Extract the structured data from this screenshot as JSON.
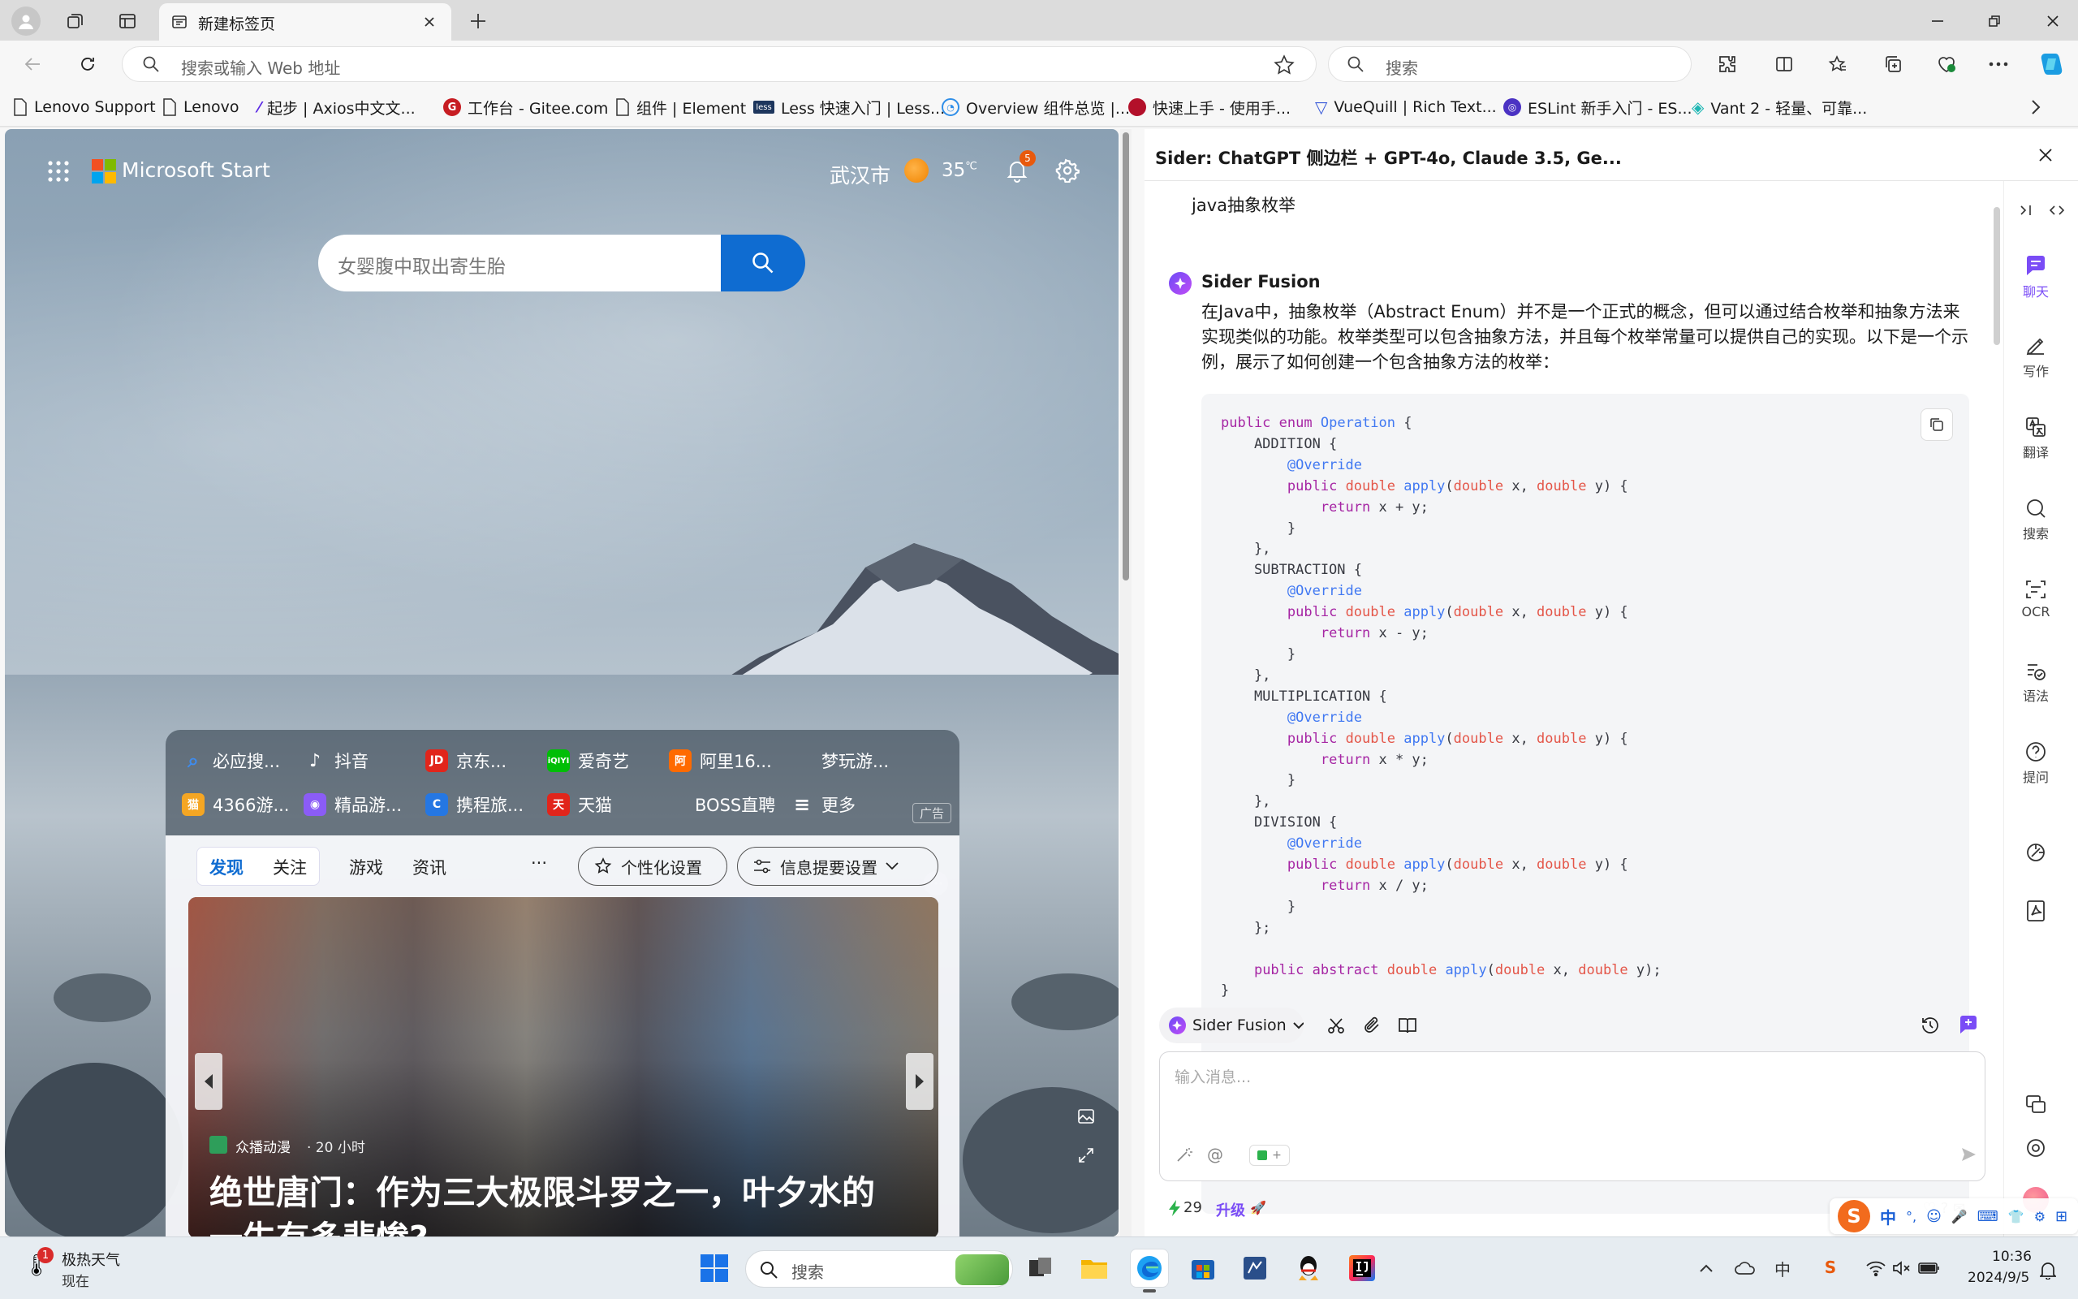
{
  "browser": {
    "tab_title": "新建标签页",
    "address_placeholder": "搜索或输入 Web 地址",
    "search_placeholder": "搜索",
    "favorites": [
      {
        "label": "Lenovo Support",
        "icon": "page-icon"
      },
      {
        "label": "Lenovo",
        "icon": "page-icon"
      },
      {
        "label": "起步 | Axios中文文...",
        "icon": "axios-icon"
      },
      {
        "label": "工作台 - Gitee.com",
        "icon": "gitee-icon"
      },
      {
        "label": "组件 | Element",
        "icon": "page-icon"
      },
      {
        "label": "Less 快速入门 | Less...",
        "icon": "less-icon"
      },
      {
        "label": "Overview 组件总览 |...",
        "icon": "overview-icon"
      },
      {
        "label": "快速上手 - 使用手...",
        "icon": "quickstart-icon"
      },
      {
        "label": "VueQuill | Rich Text...",
        "icon": "vuequill-icon"
      },
      {
        "label": "ESLint 新手入门 - ES...",
        "icon": "eslint-icon"
      },
      {
        "label": "Vant 2 - 轻量、可靠...",
        "icon": "vant-icon"
      }
    ]
  },
  "newtab": {
    "brand": "Microsoft Start",
    "city": "武汉市",
    "temperature": "35",
    "temp_unit": "℃",
    "notification_count": "5",
    "search_placeholder": "女婴腹中取出寄生胎",
    "shortcuts_row1": [
      {
        "label": "必应搜...",
        "color": "#2a6fd6",
        "glyph": "⌕"
      },
      {
        "label": "抖音",
        "color": "",
        "glyph": ""
      },
      {
        "label": "京东...",
        "color": "#e1251b",
        "glyph": "JD"
      },
      {
        "label": "爱奇艺",
        "color": "#00be06",
        "glyph": "iQ"
      },
      {
        "label": "阿里16...",
        "color": "#ff6a00",
        "glyph": "阿"
      },
      {
        "label": "梦玩游...",
        "color": "",
        "glyph": ""
      }
    ],
    "shortcuts_row2": [
      {
        "label": "4366游...",
        "color": "#f5a623",
        "glyph": "猫"
      },
      {
        "label": "精品游...",
        "color": "#8b5cf6",
        "glyph": "🎮"
      },
      {
        "label": "携程旅...",
        "color": "#2577e3",
        "glyph": "C"
      },
      {
        "label": "天猫",
        "color": "#e1251b",
        "glyph": "天"
      },
      {
        "label": "BOSS直聘",
        "color": "",
        "glyph": ""
      },
      {
        "label": "更多",
        "color": "",
        "glyph": "≡"
      }
    ],
    "ad_label": "广告",
    "feed_tabs": [
      "发现",
      "关注",
      "游戏",
      "资讯"
    ],
    "feed_more": "···",
    "personalize_button": "个性化设置",
    "info_settings_button": "信息提要设置",
    "article_source": "众播动漫",
    "article_time": "· 20 小时",
    "article_title": "绝世唐门：作为三大极限斗罗之一，叶夕水的一生有多悲惨?"
  },
  "sider": {
    "title": "Sider: ChatGPT 侧边栏 + GPT-4o, Claude 3.5, Ge...",
    "user_message": "java抽象枚举",
    "assistant_name": "Sider Fusion",
    "assistant_text": "在Java中，抽象枚举（Abstract Enum）并不是一个正式的概念，但可以通过结合枚举和抽象方法来实现类似的功能。枚举类型可以包含抽象方法，并且每个枚举常量可以提供自己的实现。以下是一个示例，展示了如何创建一个包含抽象方法的枚举：",
    "model_selector": "Sider Fusion",
    "input_placeholder": "输入消息...",
    "credits": "29",
    "upgrade_label": "升级",
    "rail": [
      {
        "label": "聊天",
        "icon": "chat-icon",
        "active": true
      },
      {
        "label": "写作",
        "icon": "write-icon",
        "active": false
      },
      {
        "label": "翻译",
        "icon": "translate-icon",
        "active": false
      },
      {
        "label": "搜索",
        "icon": "search-icon",
        "active": false
      },
      {
        "label": "OCR",
        "icon": "ocr-icon",
        "active": false
      },
      {
        "label": "语法",
        "icon": "grammar-icon",
        "active": false
      },
      {
        "label": "提问",
        "icon": "ask-icon",
        "active": false
      }
    ]
  },
  "code_lines": [
    "public enum Operation {",
    "    ADDITION {",
    "        @Override",
    "        public double apply(double x, double y) {",
    "            return x + y;",
    "        }",
    "    },",
    "    SUBTRACTION {",
    "        @Override",
    "        public double apply(double x, double y) {",
    "            return x - y;",
    "        }",
    "    },",
    "    MULTIPLICATION {",
    "        @Override",
    "        public double apply(double x, double y) {",
    "            return x * y;",
    "        }",
    "    },",
    "    DIVISION {",
    "        @Override",
    "        public double apply(double x, double y) {",
    "            return x / y;",
    "        }",
    "    };",
    "",
    "    public abstract double apply(double x, double y);",
    "}"
  ],
  "taskbar": {
    "weather_badge": "1",
    "weather_title": "极热天气",
    "weather_sub": "现在",
    "search_placeholder": "搜索",
    "ime_label": "中",
    "time": "10:36",
    "date": "2024/9/5",
    "ime_bar": [
      "中",
      "°,",
      "☺",
      "🎤",
      "⌨",
      "👕",
      "⚙",
      "⊞"
    ]
  }
}
